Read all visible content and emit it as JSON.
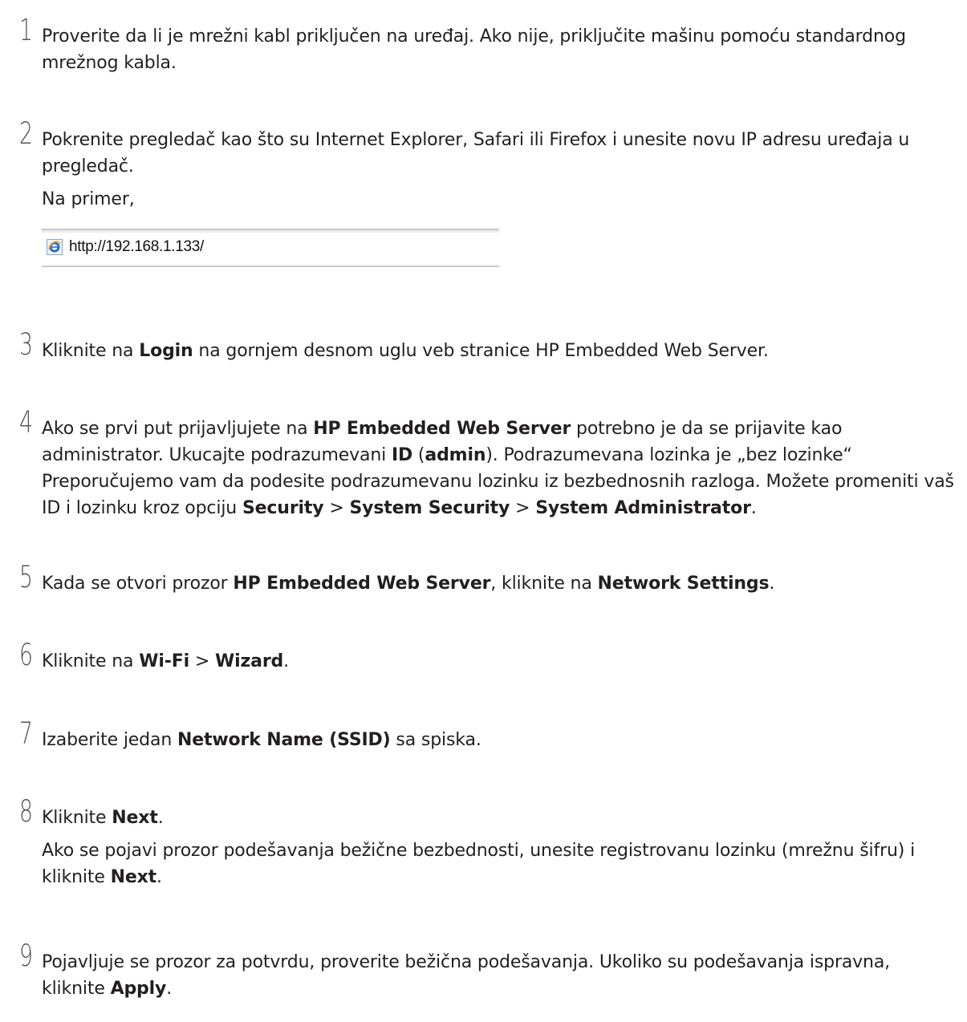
{
  "steps": [
    {
      "num": "1",
      "lines": [
        [
          {
            "t": "Proverite da li je mrežni kabl priključen na uređaj. Ako nije, priključite mašinu pomoću standardnog mrežnog kabla."
          }
        ]
      ]
    },
    {
      "num": "2",
      "lines": [
        [
          {
            "t": "Pokrenite pregledač kao što su Internet Explorer, Safari ili Firefox i unesite novu IP adresu uređaja u pregledač."
          }
        ],
        [
          {
            "t": "Na primer,"
          }
        ]
      ]
    },
    {
      "num": "3",
      "lines": [
        [
          {
            "t": "Kliknite na "
          },
          {
            "t": "Login",
            "b": true
          },
          {
            "t": " na gornjem desnom uglu veb stranice HP Embedded Web Server."
          }
        ]
      ]
    },
    {
      "num": "4",
      "lines": [
        [
          {
            "t": "Ako se prvi put prijavljujete na "
          },
          {
            "t": "HP Embedded Web Server",
            "b": true
          },
          {
            "t": " potrebno je da se prijavite kao administrator. Ukucajte podrazumevani "
          },
          {
            "t": "ID",
            "b": true
          },
          {
            "t": " ("
          },
          {
            "t": "admin",
            "b": true
          },
          {
            "t": "). Podrazumevana lozinka je „bez lozinke“ Preporučujemo vam da podesite podrazumevanu lozinku iz bezbednosnih razloga. Možete promeniti vaš ID i lozinku kroz opciju "
          },
          {
            "t": "Security",
            "b": true
          },
          {
            "t": " > "
          },
          {
            "t": "System Security",
            "b": true
          },
          {
            "t": " > "
          },
          {
            "t": "System Administrator",
            "b": true
          },
          {
            "t": "."
          }
        ]
      ]
    },
    {
      "num": "5",
      "lines": [
        [
          {
            "t": "Kada se otvori prozor "
          },
          {
            "t": "HP Embedded Web Server",
            "b": true
          },
          {
            "t": ", kliknite na "
          },
          {
            "t": "Network Settings",
            "b": true
          },
          {
            "t": "."
          }
        ]
      ]
    },
    {
      "num": "6",
      "lines": [
        [
          {
            "t": "Kliknite na "
          },
          {
            "t": "Wi-Fi",
            "b": true
          },
          {
            "t": " > "
          },
          {
            "t": "Wizard",
            "b": true
          },
          {
            "t": "."
          }
        ]
      ]
    },
    {
      "num": "7",
      "lines": [
        [
          {
            "t": "Izaberite jedan "
          },
          {
            "t": "Network Name (SSID)",
            "b": true
          },
          {
            "t": " sa spiska."
          }
        ]
      ]
    },
    {
      "num": "8",
      "lines": [
        [
          {
            "t": "Kliknite "
          },
          {
            "t": "Next",
            "b": true
          },
          {
            "t": "."
          }
        ],
        [
          {
            "t": "Ako se pojavi prozor podešavanja bežične bezbednosti, unesite registrovanu lozinku (mrežnu šifru) i kliknite "
          },
          {
            "t": "Next",
            "b": true
          },
          {
            "t": "."
          }
        ]
      ]
    },
    {
      "num": "9",
      "lines": [
        [
          {
            "t": "Pojavljuje se prozor za potvrdu, proverite bežična podešavanja. Ukoliko su podešavanja ispravna, kliknite "
          },
          {
            "t": "Apply",
            "b": true
          },
          {
            "t": "."
          }
        ]
      ]
    }
  ],
  "browser_example": {
    "icon": "internet-explorer-icon",
    "url": "http://192.168.1.133/"
  }
}
